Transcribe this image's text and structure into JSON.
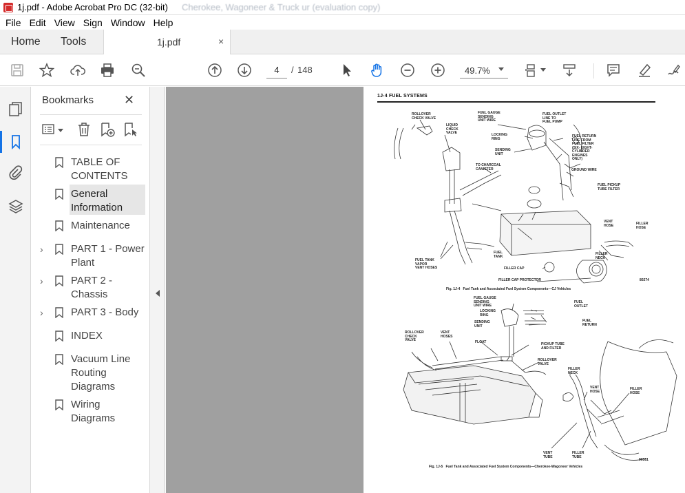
{
  "window": {
    "title": "1j.pdf - Adobe Acrobat Pro DC (32-bit)",
    "title_ghost": "Cherokee, Wagoneer & Truck ur (evaluation copy)"
  },
  "menu": [
    "File",
    "Edit",
    "View",
    "Sign",
    "Window",
    "Help"
  ],
  "tabs": {
    "home": "Home",
    "tools": "Tools",
    "document": "1j.pdf",
    "close": "×"
  },
  "toolbar": {
    "page_current": "4",
    "page_separator": "/",
    "page_total": "148",
    "zoom": "49.7%"
  },
  "bookmarks": {
    "title": "Bookmarks",
    "close": "✕",
    "items": [
      {
        "label": "TABLE OF CONTENTS",
        "expandable": false,
        "selected": false
      },
      {
        "label": "General Information",
        "expandable": false,
        "selected": true
      },
      {
        "label": "Maintenance",
        "expandable": false,
        "selected": false
      },
      {
        "label": "PART 1 - Power Plant",
        "expandable": true,
        "selected": false
      },
      {
        "label": "PART 2 - Chassis",
        "expandable": true,
        "selected": false
      },
      {
        "label": "PART 3 - Body",
        "expandable": true,
        "selected": false
      },
      {
        "label": "INDEX",
        "expandable": false,
        "selected": false
      },
      {
        "label": "Vacuum Line Routing Diagrams",
        "expandable": false,
        "selected": false
      },
      {
        "label": "Wiring Diagrams",
        "expandable": false,
        "selected": false
      }
    ]
  },
  "document_page": {
    "header": "1J-4   FUEL SYSTEMS",
    "fig1_caption": "Fig. 1J-4   Fuel Tank and Associated Fuel System Components—CJ Vehicles",
    "fig1_number": "80274",
    "fig2_caption": "Fig. 1J-5   Fuel Tank and Associated Fuel System Components—Cherokee-Wagoneer Vehicles",
    "fig2_number": "90581",
    "fig1_labels": {
      "rollover": "ROLLOVER\nCHECK VALVE",
      "liquid": "LIQUID\nCHECK\nVALVE",
      "gauge": "FUEL GAUGE\nSENDING\nUNIT WIRE",
      "outlet": "FUEL OUTLET\nLINE TO\nFUEL PUMP",
      "locking": "LOCKING\nRING",
      "return": "FUEL RETURN\nLINE FROM\nFUEL FILTER\n(SIX- EIGHT-\nCYLINDER\nENGINES\nONLY)",
      "sending": "SENDING\nUNIT",
      "charcoal": "TO CHARCOAL\nCANISTER",
      "ground": "GROUND WIRE",
      "pickup": "FUEL PICKUP\nTUBE FILTER",
      "vent_hose": "VENT\nHOSE",
      "filler_hose": "FILLER\nHOSE",
      "fuel_tank": "FUEL\nTANK",
      "vapor": "FUEL TANK\nVAPOR\nVENT HOSES",
      "filler_neck": "FILLER\nNECK",
      "filler_cap": "FILLER CAP",
      "cap_protector": "FILLER CAP PROTECTOR"
    },
    "fig2_labels": {
      "gauge": "FUEL GAUGE\nSENDING\nUNIT WIRE",
      "outlet": "FUEL\nOUTLET",
      "locking": "LOCKING\nRING",
      "return": "FUEL\nRETURN",
      "sending": "SENDING\nUNIT",
      "rollover": "ROLLOVER\nCHECK\nVALVE",
      "vent_hoses": "VENT\nHOSES",
      "float": "FLOAT",
      "pickup": "PICKUP TUBE\nAND FILTER",
      "roll_valve": "ROLLOVER\nVALVE",
      "filler_neck": "FILLER\nNECK",
      "vent_hose": "VENT\nHOSE",
      "filler_hose": "FILLER\nHOSE",
      "vent_tube": "VENT\nTUBE",
      "filler_tube": "FILLER\nTUBE"
    }
  }
}
